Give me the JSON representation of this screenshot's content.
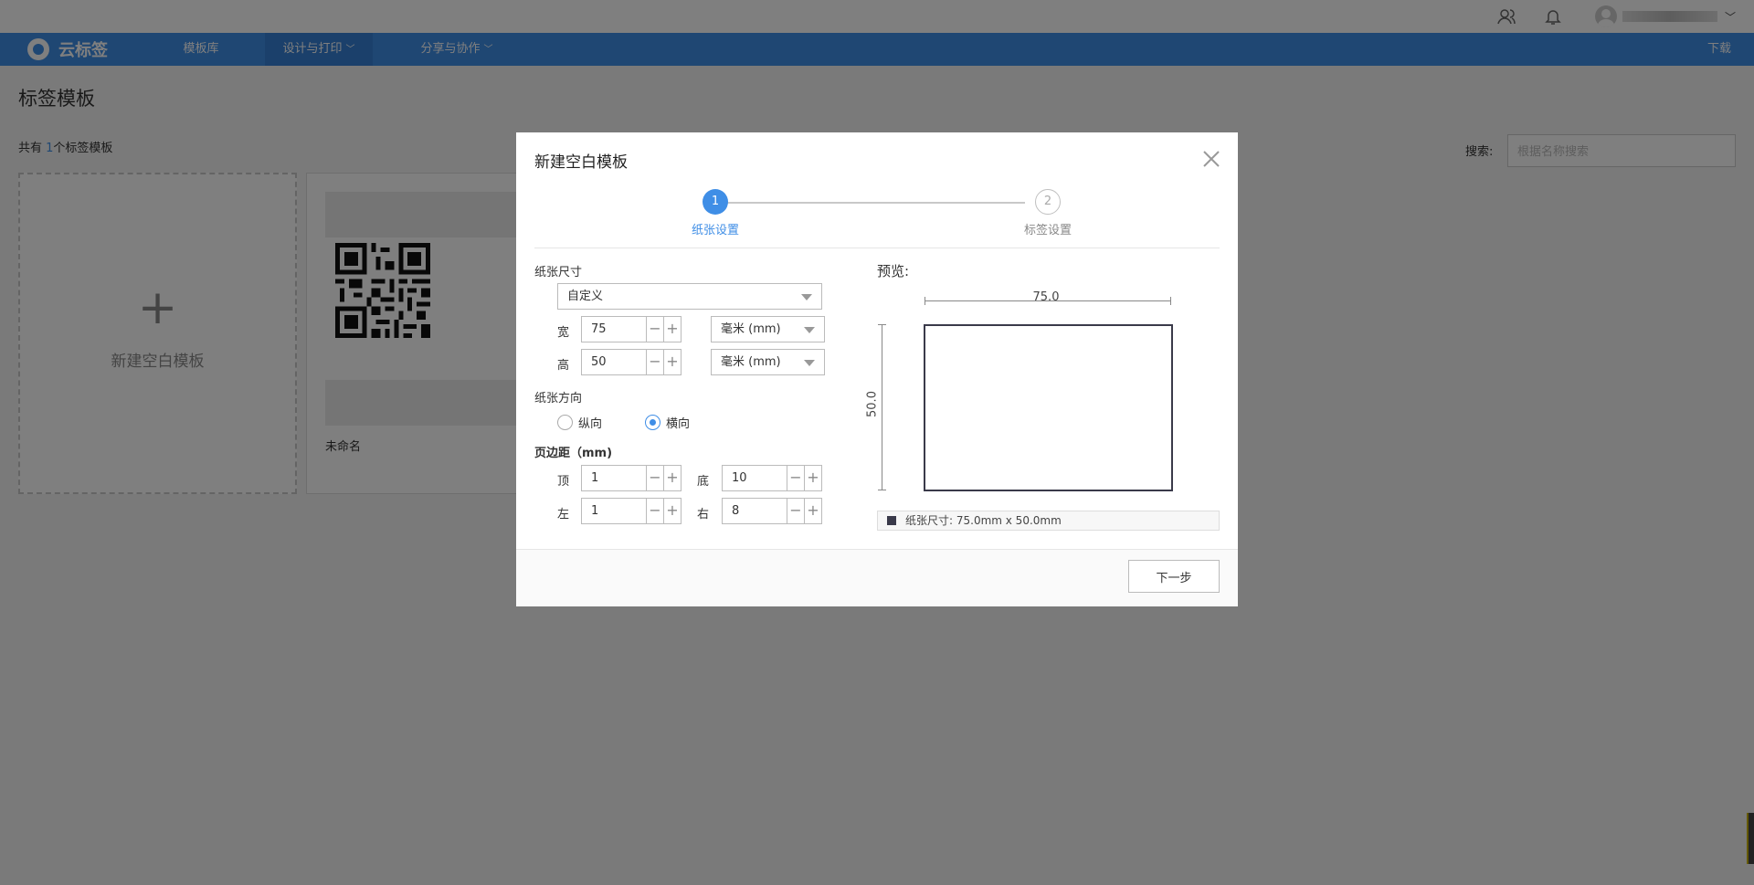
{
  "nav": {
    "logo_text": "云标签",
    "items": [
      {
        "label": "模板库"
      },
      {
        "label": "设计与打印"
      },
      {
        "label": "分享与协作"
      }
    ],
    "download": "下载"
  },
  "page": {
    "title": "标签模板",
    "count_prefix": "共有 ",
    "count_num": "1",
    "count_suffix": "个标签模板",
    "search_label": "搜索:",
    "search_placeholder": "根据名称搜索",
    "new_card_label": "新建空白模板",
    "template_name": "未命名"
  },
  "modal": {
    "title": "新建空白模板",
    "steps": [
      {
        "num": "1",
        "label": "纸张设置"
      },
      {
        "num": "2",
        "label": "标签设置"
      }
    ],
    "paper_size_label": "纸张尺寸",
    "paper_size_value": "自定义",
    "width_label": "宽",
    "width_value": "75",
    "height_label": "高",
    "height_value": "50",
    "unit_value": "毫米 (mm)",
    "orientation_label": "纸张方向",
    "orientation_portrait": "纵向",
    "orientation_landscape": "横向",
    "margin_label": "页边距（mm)",
    "margin_top_label": "顶",
    "margin_top": "1",
    "margin_bottom_label": "底",
    "margin_bottom": "10",
    "margin_left_label": "左",
    "margin_left": "1",
    "margin_right_label": "右",
    "margin_right": "8",
    "preview_label": "预览:",
    "preview_width": "75.0",
    "preview_height": "50.0",
    "size_info": "纸张尺寸:  75.0mm x 50.0mm",
    "next_button": "下一步"
  }
}
